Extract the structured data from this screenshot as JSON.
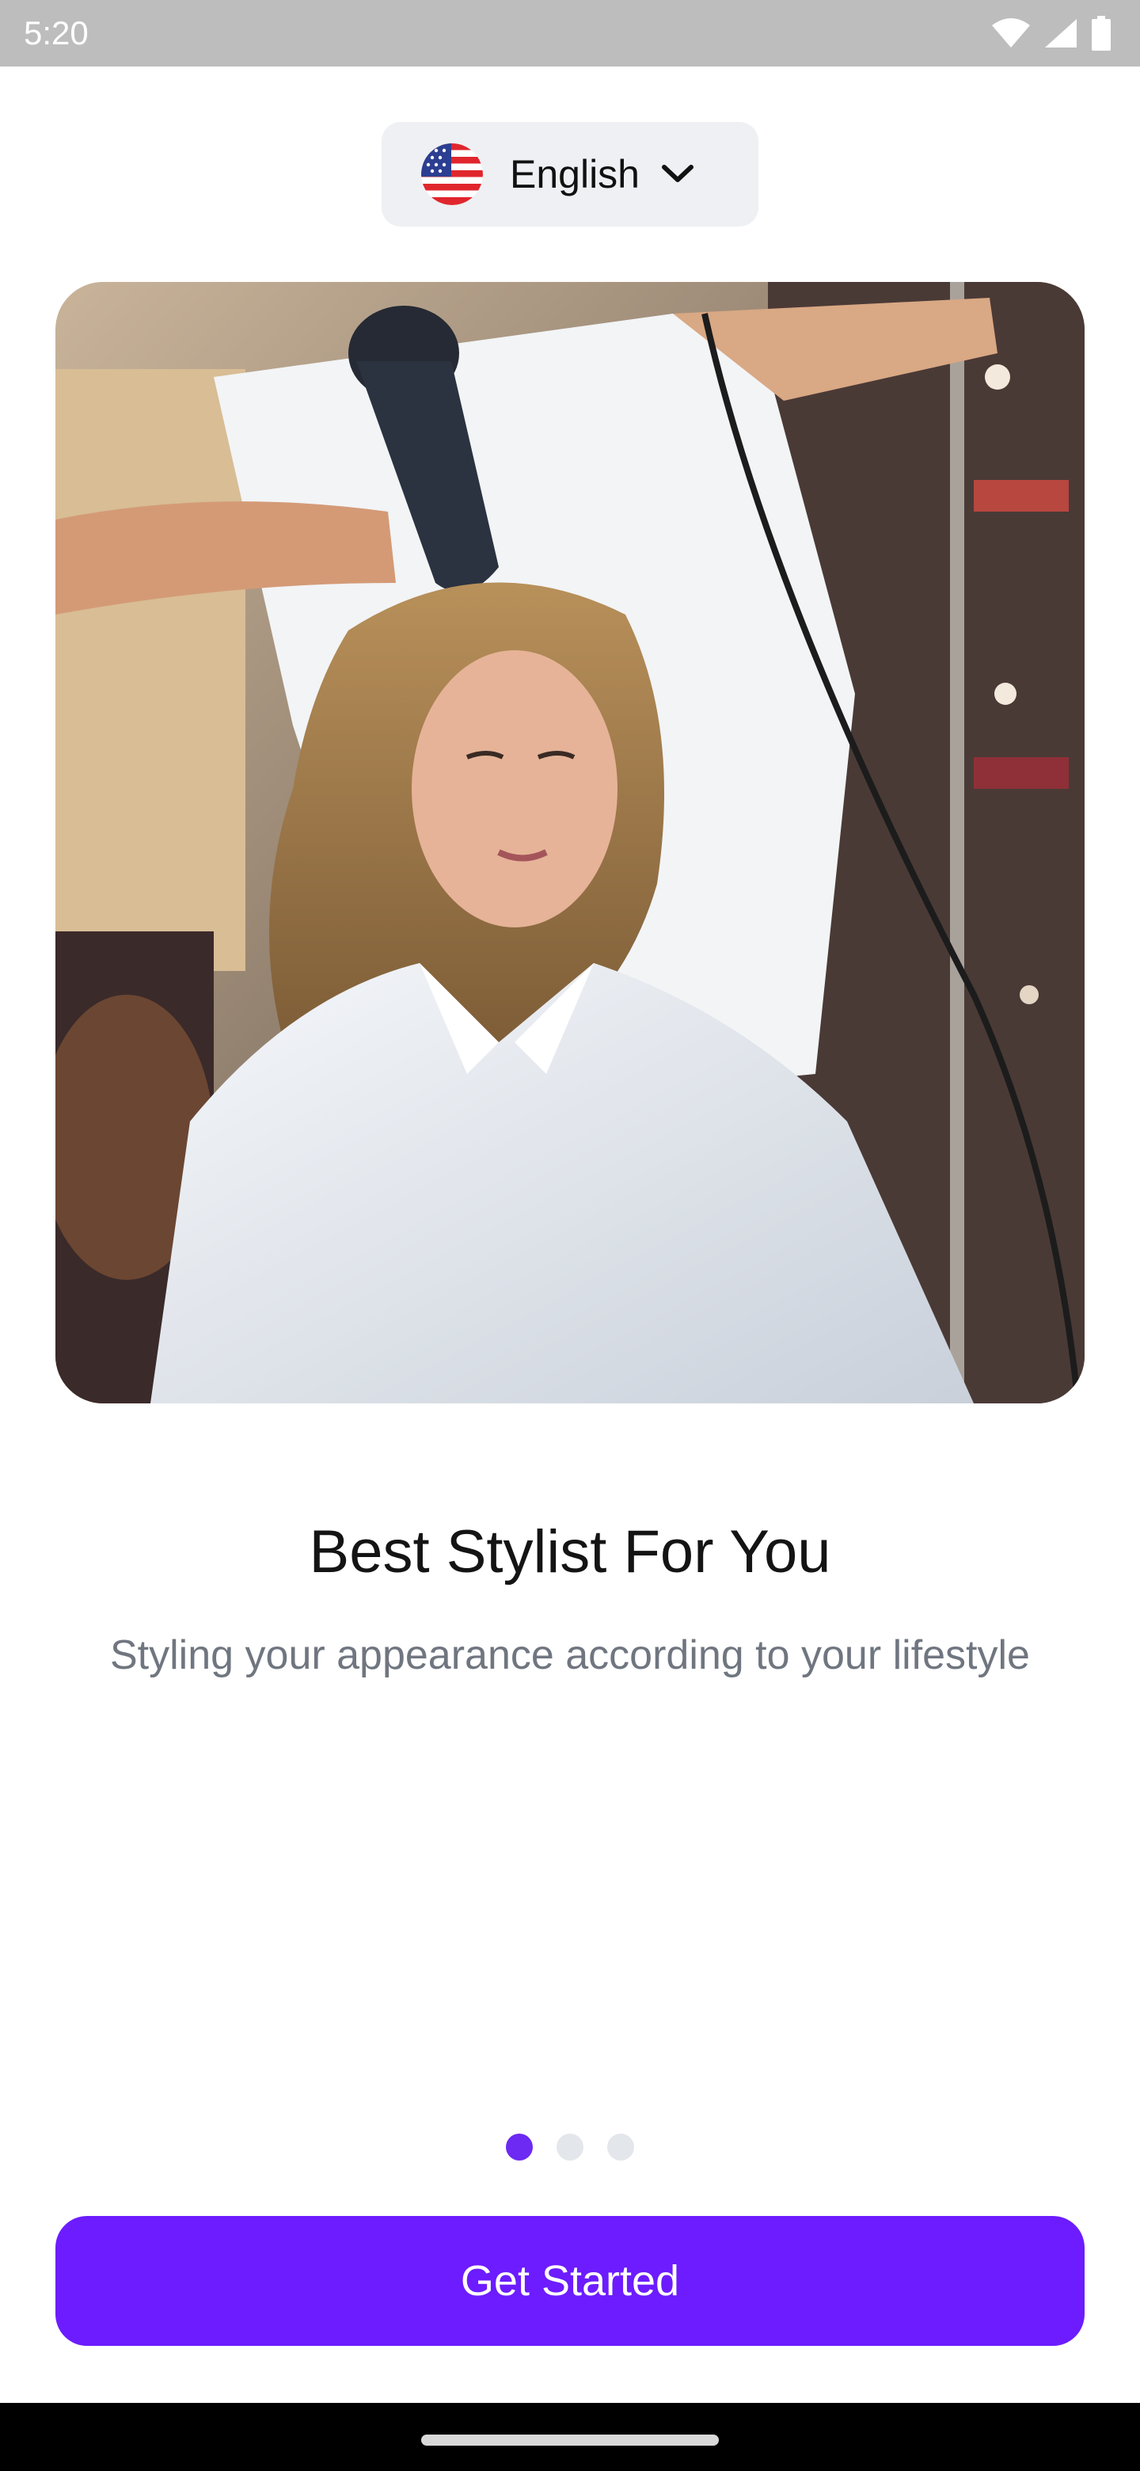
{
  "status_bar": {
    "time": "5:20",
    "icons": [
      "wifi-icon",
      "signal-icon",
      "battery-icon"
    ]
  },
  "language_selector": {
    "label": "English",
    "flag_icon": "us-flag-icon",
    "chevron_icon": "chevron-down-icon"
  },
  "hero": {
    "image": "stylist-drying-hair-photo"
  },
  "onboarding": {
    "title": "Best Stylist For You",
    "subtitle": "Styling your appearance according to your lifestyle",
    "page_count": 3,
    "active_page": 1
  },
  "cta": {
    "label": "Get Started"
  },
  "colors": {
    "accent": "#6C1CFF",
    "dot_inactive": "#E3E6EA",
    "selector_bg": "#EEF0F3",
    "subtitle_text": "#707680"
  }
}
